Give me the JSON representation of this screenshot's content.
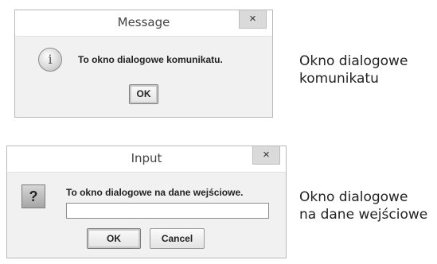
{
  "message_dialog": {
    "title": "Message",
    "close_glyph": "×",
    "icon_glyph": "i",
    "text": "To okno dialogowe komunikatu.",
    "ok_label": "OK"
  },
  "input_dialog": {
    "title": "Input",
    "close_glyph": "×",
    "icon_glyph": "?",
    "prompt": "To okno dialogowe na dane wejściowe.",
    "field_value": "",
    "ok_label": "OK",
    "cancel_label": "Cancel"
  },
  "captions": {
    "message_line1": "Okno dialogowe",
    "message_line2": "komunikatu",
    "input_line1": "Okno dialogowe",
    "input_line2": "na dane wejściowe"
  },
  "icons": {
    "message_icon": "info-icon",
    "input_icon": "question-icon",
    "close": "close-icon"
  }
}
